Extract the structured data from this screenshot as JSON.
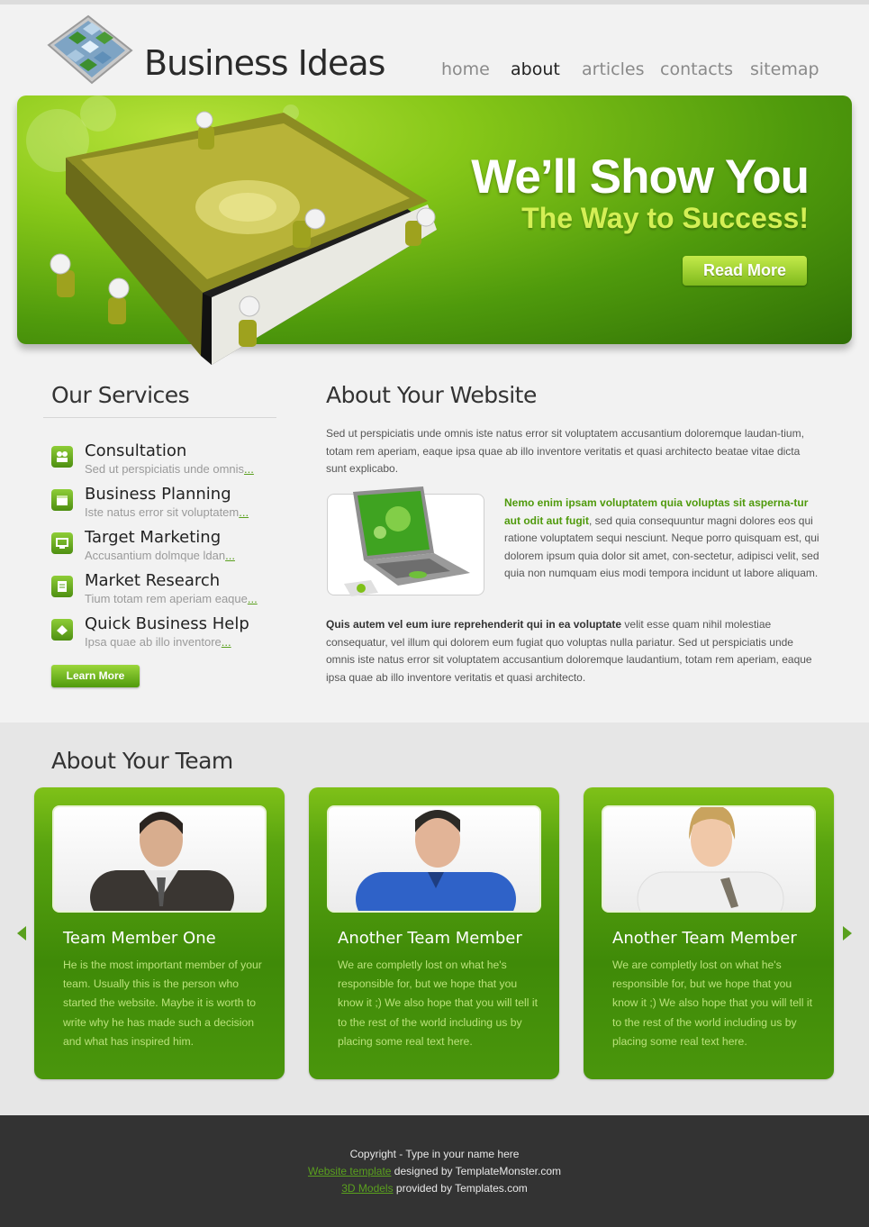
{
  "header": {
    "logo_text": "Business Ideas",
    "nav": [
      "home",
      "about",
      "articles",
      "contacts",
      "sitemap"
    ],
    "active_nav": "about"
  },
  "banner": {
    "title": "We’ll Show You",
    "subtitle": "The Way to Success!",
    "button": "Read More"
  },
  "services": {
    "title": "Our Services",
    "items": [
      {
        "name": "Consultation",
        "desc": "Sed ut perspiciatis unde omnis",
        "more": "..."
      },
      {
        "name": "Business Planning",
        "desc": "Iste natus error sit voluptatem",
        "more": "..."
      },
      {
        "name": "Target Marketing",
        "desc": "Accusantium dolmque ldan",
        "more": "..."
      },
      {
        "name": "Market Research",
        "desc": "Tium totam rem aperiam eaque",
        "more": "..."
      },
      {
        "name": "Quick Business Help",
        "desc": "Ipsa quae ab illo inventore",
        "more": "..."
      }
    ],
    "button": "Learn More"
  },
  "about": {
    "title": "About Your Website",
    "p1": "Sed ut perspiciatis unde omnis iste natus error sit voluptatem accusantium doloremque laudan-tium, totam rem aperiam, eaque ipsa quae ab illo inventore veritatis et quasi architecto beatae vitae dicta sunt explicabo.",
    "p2_lead": "Nemo enim ipsam voluptatem quia voluptas sit asperna-tur aut odit aut fugit",
    "p2_rest": ", sed quia consequuntur magni dolores eos qui ratione voluptatem sequi nesciunt. Neque porro quisquam est, qui dolorem ipsum quia dolor sit amet, con-sectetur, adipisci velit, sed quia non numquam eius modi tempora incidunt ut labore aliquam.",
    "p3_lead": "Quis autem vel eum iure reprehenderit qui in ea voluptate",
    "p3_rest": " velit esse quam nihil molestiae consequatur, vel illum qui dolorem eum fugiat quo voluptas nulla pariatur. Sed ut perspiciatis unde omnis iste natus error sit voluptatem accusantium doloremque laudantium, totam rem aperiam, eaque ipsa quae ab illo inventore veritatis et quasi architecto."
  },
  "team": {
    "title": "About Your Team",
    "members": [
      {
        "name": "Team Member One",
        "bio": "He is the most important member of your team. Usually this is the person who started the website. Maybe it is worth to write why he has made such a decision and what has inspired him."
      },
      {
        "name": "Another Team Member",
        "bio": "We are completly lost on what he's responsible for, but we hope that you know it ;) We also hope that you will tell it to the rest of the world including us by placing some real text here."
      },
      {
        "name": "Another Team Member",
        "bio": "We are completly lost on what he's responsible for, but we hope that you know it ;) We also hope that you will tell it to the rest of the world including us by placing some real text here."
      }
    ]
  },
  "footer": {
    "copyright": "Copyright - Type in your name here",
    "link1": "Website template",
    "text1": " designed by TemplateMonster.com",
    "link2": "3D Models",
    "text2": " provided by Templates.com"
  },
  "colors": {
    "accent": "#5aa01e",
    "banner_dark": "#2f6f06",
    "footer_bg": "#333333"
  }
}
